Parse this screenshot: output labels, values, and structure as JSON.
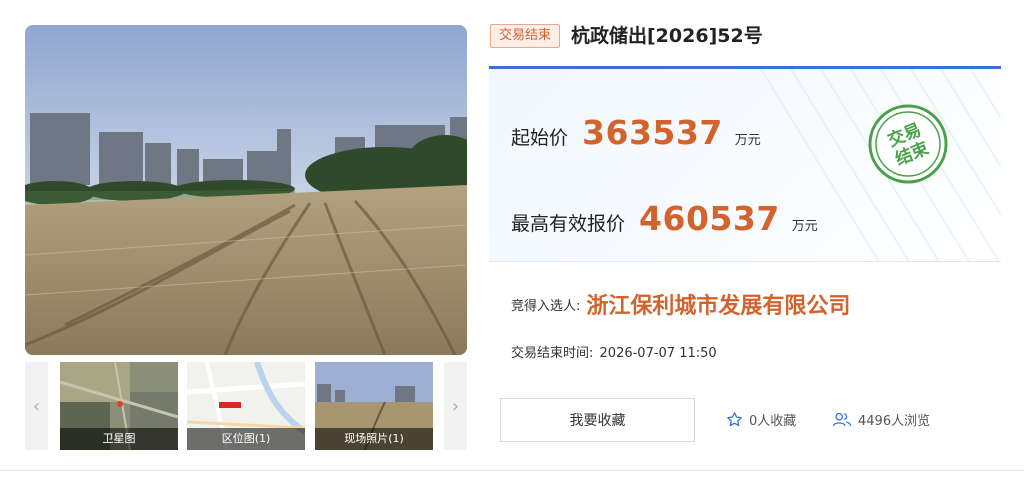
{
  "listing": {
    "status_tag": "交易结束",
    "title": "杭政储出[2026]52号"
  },
  "gallery": {
    "thumbnails": [
      {
        "caption": "卫星图",
        "icon": "satellite-map"
      },
      {
        "caption": "区位图(1)",
        "icon": "location-map"
      },
      {
        "caption": "现场照片(1)",
        "icon": "site-photo"
      }
    ],
    "prev_icon": "chevron-left-icon",
    "next_icon": "chevron-right-icon"
  },
  "pricing": {
    "start_label": "起始价",
    "start_value": "363537",
    "start_unit": "万元",
    "max_label": "最高有效报价",
    "max_value": "460537",
    "max_unit": "万元",
    "stamp_line1": "交易",
    "stamp_line2": "结束"
  },
  "result": {
    "winner_label": "竞得入选人:",
    "winner_value": "浙江保利城市发展有限公司",
    "endtime_label": "交易结束时间:",
    "endtime_value": "2026-07-07 11:50"
  },
  "actions": {
    "favorite_button": "我要收藏",
    "favorite_count": "0人收藏",
    "view_count": "4496人浏览"
  },
  "colors": {
    "accent_orange": "#d3632c",
    "accent_blue": "#3a6fd8",
    "stamp_green": "#4aa14a"
  }
}
